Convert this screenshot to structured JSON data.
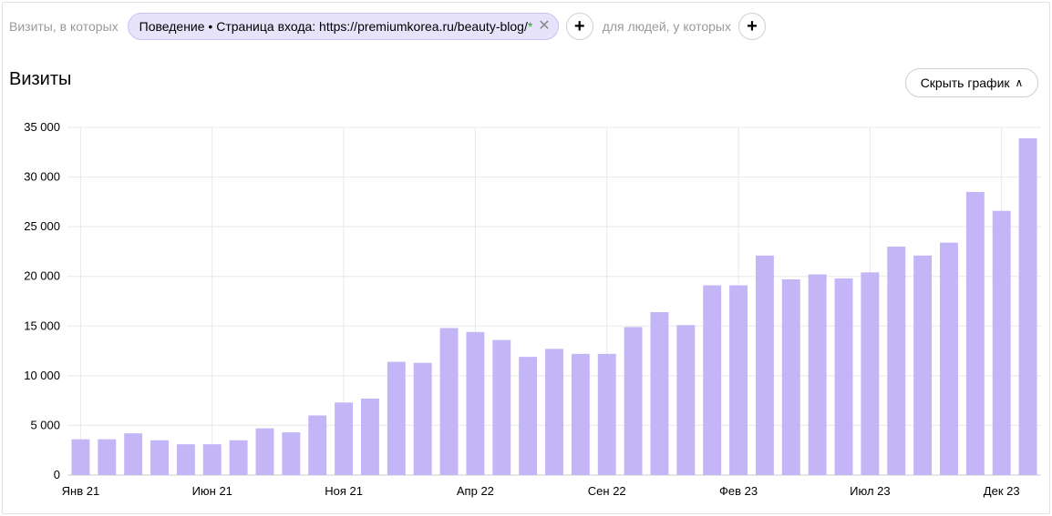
{
  "filter": {
    "visits_label": "Визиты, в которых",
    "segment_chip": "Поведение • Страница входа: https://premiumkorea.ru/beauty-blog/",
    "segment_star": "*",
    "add_symbol": "+",
    "people_label": "для людей, у которых"
  },
  "header": {
    "title": "Визиты",
    "hide_chart_button": "Скрыть график"
  },
  "colors": {
    "bar": "#c4b5f7",
    "grid": "#e8e8e8",
    "axis": "#cccccc"
  },
  "chart_data": {
    "type": "bar",
    "title": "Визиты",
    "xlabel": "",
    "ylabel": "",
    "ylim": [
      0,
      35000
    ],
    "yticks": [
      0,
      5000,
      10000,
      15000,
      20000,
      25000,
      30000,
      35000
    ],
    "ytick_labels": [
      "0",
      "5 000",
      "10 000",
      "15 000",
      "20 000",
      "25 000",
      "30 000",
      "35 000"
    ],
    "x_tick_labels": [
      {
        "index": 0,
        "label": "Янв 21"
      },
      {
        "index": 5,
        "label": "Июн 21"
      },
      {
        "index": 10,
        "label": "Ноя 21"
      },
      {
        "index": 15,
        "label": "Апр 22"
      },
      {
        "index": 20,
        "label": "Сен 22"
      },
      {
        "index": 25,
        "label": "Фев 23"
      },
      {
        "index": 30,
        "label": "Июл 23"
      },
      {
        "index": 35,
        "label": "Дек 23"
      }
    ],
    "values": [
      3600,
      3600,
      4200,
      3500,
      3100,
      3100,
      3500,
      4700,
      4300,
      6000,
      7300,
      7700,
      11400,
      11300,
      14800,
      14400,
      13600,
      11900,
      12700,
      12200,
      12200,
      14900,
      16400,
      15100,
      19100,
      19100,
      22100,
      19700,
      20200,
      19800,
      20400,
      23000,
      22100,
      23400,
      28500,
      26600,
      33900
    ],
    "grid": true,
    "legend": "none"
  }
}
